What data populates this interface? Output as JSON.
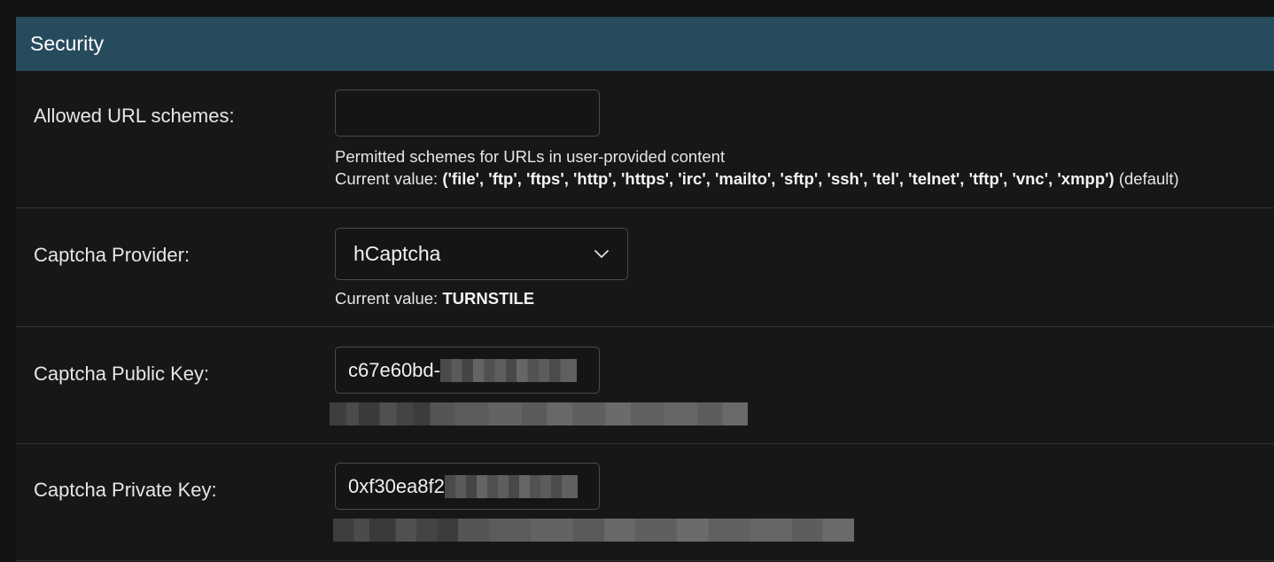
{
  "section": {
    "title": "Security"
  },
  "fields": {
    "allowed_url_schemes": {
      "label": "Allowed URL schemes:",
      "value": "",
      "help": "Permitted schemes for URLs in user-provided content",
      "current_prefix": "Current value:",
      "current_value": "('file', 'ftp', 'ftps', 'http', 'https', 'irc', 'mailto', 'sftp', 'ssh', 'tel', 'telnet', 'tftp', 'vnc', 'xmpp')",
      "current_suffix": "(default)"
    },
    "captcha_provider": {
      "label": "Captcha Provider:",
      "selected": "hCaptcha",
      "current_prefix": "Current value:",
      "current_value": "TURNSTILE"
    },
    "captcha_public_key": {
      "label": "Captcha Public Key:",
      "value_visible": "c67e60bd-"
    },
    "captcha_private_key": {
      "label": "Captcha Private Key:",
      "value_visible": "0xf30ea8f2"
    }
  },
  "icons": {
    "select_chevron": "chevron-down-icon"
  },
  "colors": {
    "header_bg": "#264b5d",
    "page_bg": "#121212"
  }
}
